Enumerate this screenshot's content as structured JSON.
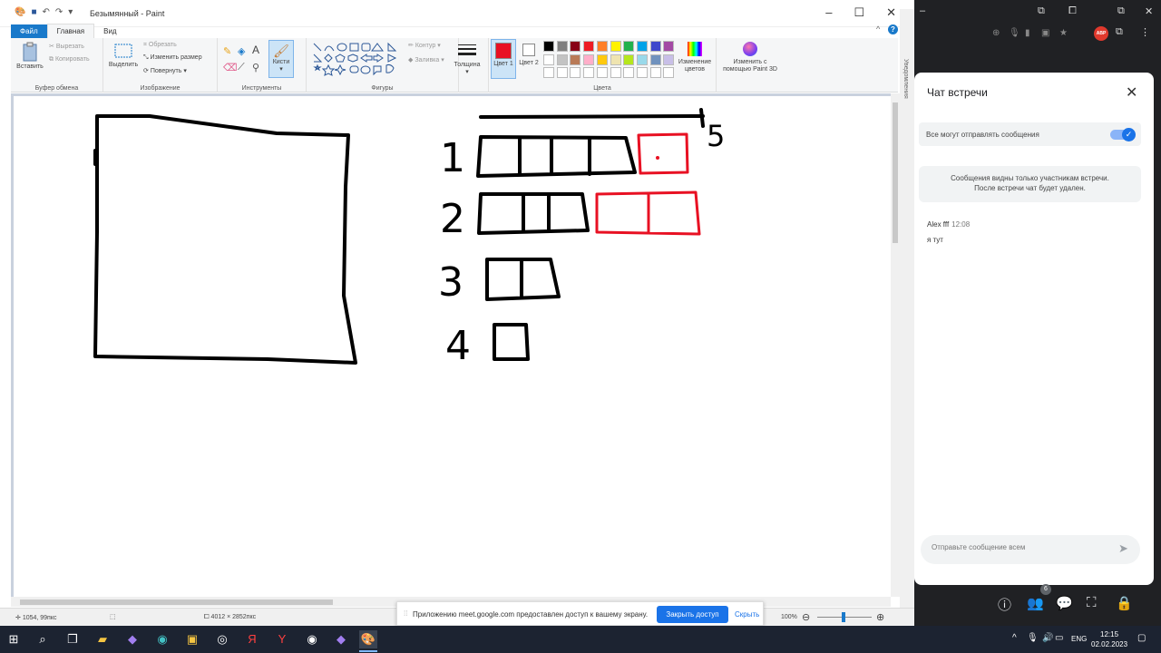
{
  "paint": {
    "window_title": "Безымянный - Paint",
    "tabs": [
      "Файл",
      "Главная",
      "Вид"
    ],
    "clipboard": {
      "paste": "Вставить",
      "cut": "Вырезать",
      "copy": "Копировать",
      "group": "Буфер обмена"
    },
    "image": {
      "select": "Выделить",
      "crop": "Обрезать",
      "resize": "Изменить размер",
      "rotate": "Повернуть",
      "group": "Изображение"
    },
    "tools": {
      "group": "Инструменты",
      "brushes": "Кисти"
    },
    "shapes": {
      "outline": "Контур",
      "fill": "Заливка",
      "group": "Фигуры"
    },
    "size_label": "Толщина",
    "color1": {
      "label": "Цвет 1",
      "value": "#e81123"
    },
    "color2": {
      "label": "Цвет 2",
      "value": "#ffffff"
    },
    "colors_group": "Цвета",
    "palette": [
      "#000000",
      "#7f7f7f",
      "#880015",
      "#ed1c24",
      "#ff7f27",
      "#fff200",
      "#22b14c",
      "#00a2e8",
      "#3f48cc",
      "#a349a4",
      "#ffffff",
      "#c3c3c3",
      "#b97a57",
      "#ffaec9",
      "#ffc90e",
      "#efe4b0",
      "#b5e61d",
      "#99d9ea",
      "#7092be",
      "#c8bfe7"
    ],
    "edit_colors": "Изменение цветов",
    "paint3d": "Изменить с помощью Paint 3D",
    "side_label": "Уведомления",
    "status": {
      "position": "1054, 99пкс",
      "canvas_size": "4012 × 2852пкс",
      "zoom": "100%"
    },
    "drawing": {
      "numbers": [
        "1",
        "2",
        "3",
        "4",
        "5"
      ]
    }
  },
  "share_banner": {
    "message": "Приложению meet.google.com предоставлен доступ к вашему экрану.",
    "stop": "Закрыть доступ",
    "hide": "Скрыть"
  },
  "meet": {
    "chat_title": "Чат встречи",
    "toggle_label": "Все могут отправлять сообщения",
    "notice_line1": "Сообщения видны только участникам встречи.",
    "notice_line2": "После встречи чат будет удален.",
    "author": "Alex fff",
    "time": "12:08",
    "message": "я тут",
    "compose_placeholder": "Отправьте сообщение всем",
    "participants_count": "6"
  },
  "taskbar": {
    "lang": "ENG",
    "time": "12:15",
    "date": "02.02.2023"
  }
}
